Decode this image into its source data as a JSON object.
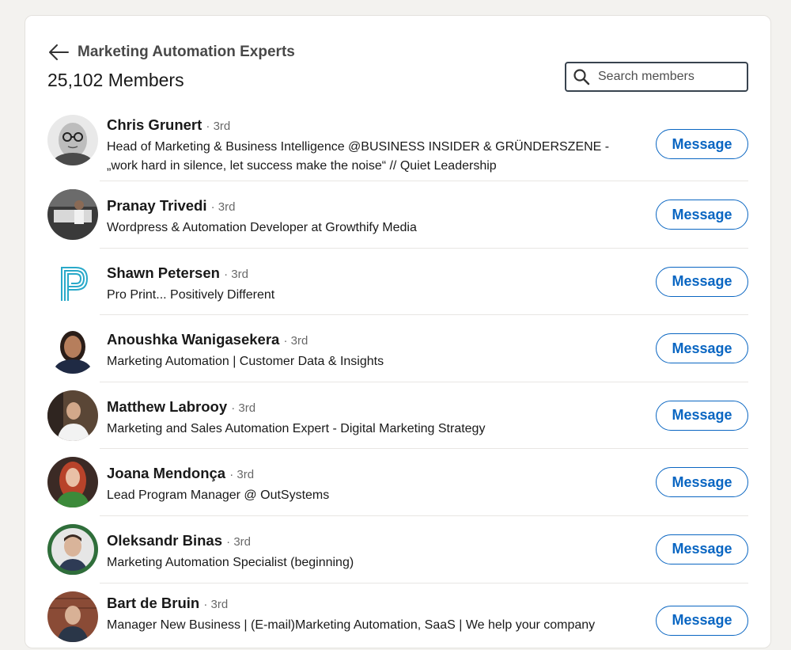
{
  "header": {
    "back_icon": "arrow-left-icon",
    "title": "Marketing Automation Experts",
    "members_count": "25,102 Members"
  },
  "search": {
    "placeholder": "Search members",
    "icon": "search-icon"
  },
  "members": [
    {
      "name": "Chris Grunert",
      "degree": "· 3rd",
      "headline": "Head of Marketing & Business Intelligence @BUSINESS INSIDER & GRÜNDERSZENE -",
      "headline2": "„work hard in silence, let success make the noise“ // Quiet Leadership",
      "button": "Message"
    },
    {
      "name": "Pranay Trivedi",
      "degree": "· 3rd",
      "headline": "Wordpress & Automation Developer at Growthify Media",
      "button": "Message"
    },
    {
      "name": "Shawn Petersen",
      "degree": "· 3rd",
      "headline": "Pro Print... Positively Different",
      "button": "Message"
    },
    {
      "name": "Anoushka Wanigasekera",
      "degree": "· 3rd",
      "headline": "Marketing Automation | Customer Data & Insights",
      "button": "Message"
    },
    {
      "name": "Matthew Labrooy",
      "degree": "· 3rd",
      "headline": "Marketing and Sales Automation Expert - Digital Marketing Strategy",
      "button": "Message"
    },
    {
      "name": "Joana Mendonça",
      "degree": "· 3rd",
      "headline": "Lead Program Manager @ OutSystems",
      "button": "Message"
    },
    {
      "name": "Oleksandr Binas",
      "degree": "· 3rd",
      "headline": "Marketing Automation Specialist (beginning)",
      "button": "Message"
    },
    {
      "name": "Bart de Bruin",
      "degree": "· 3rd",
      "headline": "Manager New Business | (E-mail)Marketing Automation, SaaS | We help your company",
      "button": "Message"
    }
  ],
  "colors": {
    "accent": "#0a66c2",
    "background": "#f3f2ef"
  }
}
